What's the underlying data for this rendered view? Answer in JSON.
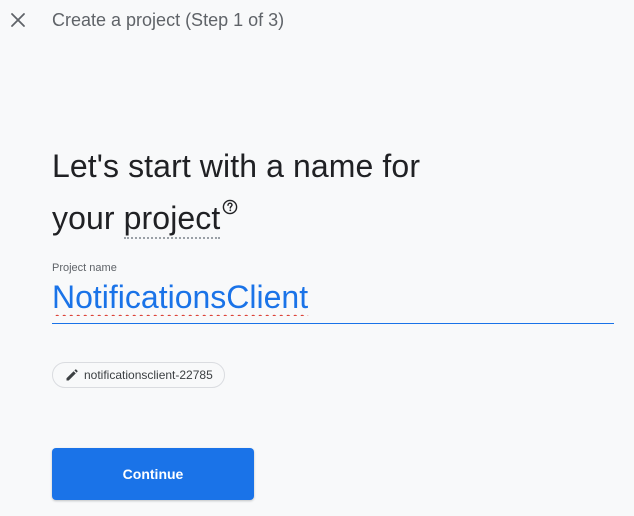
{
  "header": {
    "close_icon": "close-icon",
    "step_title": "Create a project (Step 1 of 3)"
  },
  "main": {
    "heading_line1": "Let's start with a name for",
    "heading_line2_prefix": "your ",
    "heading_link_word": "project",
    "help_icon": "help-circle-icon"
  },
  "project_name_field": {
    "label": "Project name",
    "value": "NotificationsClient"
  },
  "project_id_chip": {
    "icon": "pencil-icon",
    "text": "notificationsclient-22785"
  },
  "actions": {
    "continue_label": "Continue"
  },
  "colors": {
    "accent": "#1a73e8",
    "background": "#f8f9fa",
    "spellcheck": "#d93025"
  }
}
